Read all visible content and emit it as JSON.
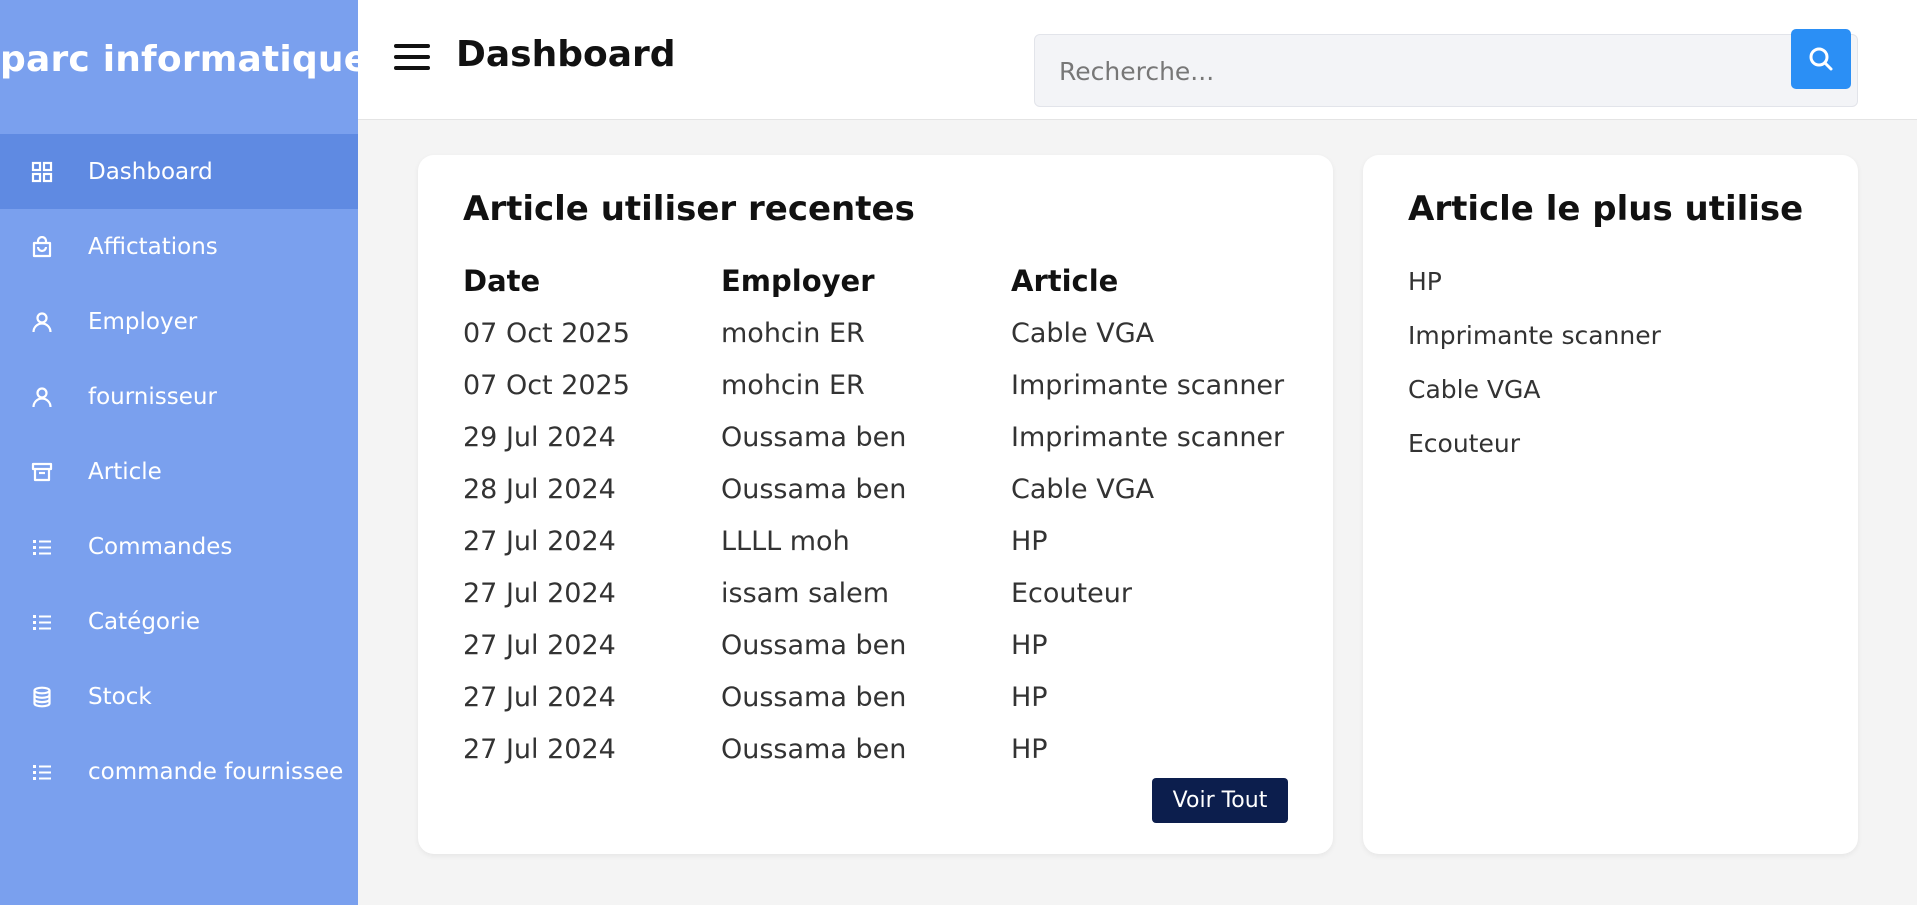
{
  "sidebar": {
    "brand": "parc informatique",
    "items": [
      {
        "label": "Dashboard",
        "icon": "grid-icon"
      },
      {
        "label": "Affictations",
        "icon": "bag-icon"
      },
      {
        "label": "Employer",
        "icon": "user-icon"
      },
      {
        "label": "fournisseur",
        "icon": "user-icon"
      },
      {
        "label": "Article",
        "icon": "archive-icon"
      },
      {
        "label": "Commandes",
        "icon": "list-icon"
      },
      {
        "label": "Catégorie",
        "icon": "list-icon"
      },
      {
        "label": "Stock",
        "icon": "database-icon"
      },
      {
        "label": "commande fournissee",
        "icon": "list-icon"
      }
    ],
    "active_index": 0
  },
  "header": {
    "title": "Dashboard",
    "search_placeholder": "Recherche..."
  },
  "recent": {
    "title": "Article utiliser recentes",
    "columns": [
      "Date",
      "Employer",
      "Article"
    ],
    "rows": [
      [
        "07 Oct 2025",
        "mohcin ER",
        "Cable VGA"
      ],
      [
        "07 Oct 2025",
        "mohcin ER",
        "Imprimante scanner"
      ],
      [
        "29 Jul 2024",
        "Oussama ben",
        "Imprimante scanner"
      ],
      [
        "28 Jul 2024",
        "Oussama ben",
        "Cable VGA"
      ],
      [
        "27 Jul 2024",
        "LLLL moh",
        "HP"
      ],
      [
        "27 Jul 2024",
        "issam salem",
        "Ecouteur"
      ],
      [
        "27 Jul 2024",
        "Oussama ben",
        "HP"
      ],
      [
        "27 Jul 2024",
        "Oussama ben",
        "HP"
      ],
      [
        "27 Jul 2024",
        "Oussama ben",
        "HP"
      ]
    ],
    "button_label": "Voir Tout"
  },
  "most_used": {
    "title": "Article le plus utilise",
    "items": [
      "HP",
      "Imprimante scanner",
      "Cable VGA",
      "Ecouteur"
    ]
  },
  "colors": {
    "sidebar_bg": "#7aa0ee",
    "sidebar_active": "#5f8ae2",
    "search_button": "#2b8ff5",
    "voir_button": "#0c1e4d"
  }
}
